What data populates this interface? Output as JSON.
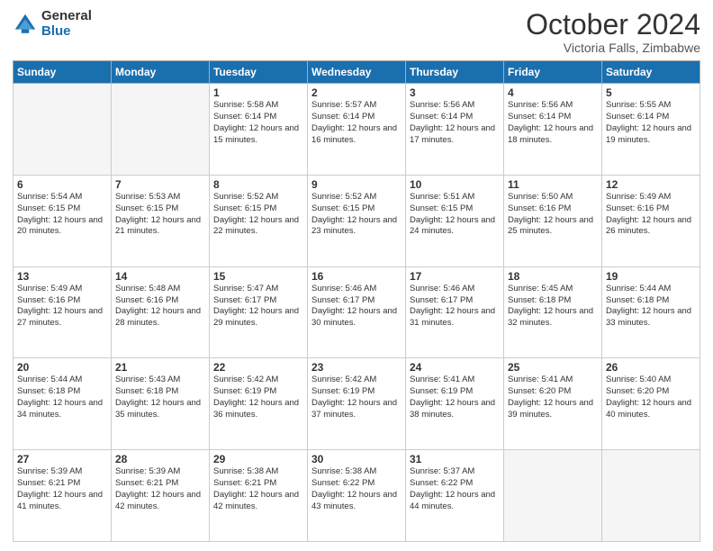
{
  "logo": {
    "general": "General",
    "blue": "Blue"
  },
  "header": {
    "month": "October 2024",
    "location": "Victoria Falls, Zimbabwe"
  },
  "days_of_week": [
    "Sunday",
    "Monday",
    "Tuesday",
    "Wednesday",
    "Thursday",
    "Friday",
    "Saturday"
  ],
  "weeks": [
    [
      {
        "day": "",
        "info": ""
      },
      {
        "day": "",
        "info": ""
      },
      {
        "day": "1",
        "info": "Sunrise: 5:58 AM\nSunset: 6:14 PM\nDaylight: 12 hours and 15 minutes."
      },
      {
        "day": "2",
        "info": "Sunrise: 5:57 AM\nSunset: 6:14 PM\nDaylight: 12 hours and 16 minutes."
      },
      {
        "day": "3",
        "info": "Sunrise: 5:56 AM\nSunset: 6:14 PM\nDaylight: 12 hours and 17 minutes."
      },
      {
        "day": "4",
        "info": "Sunrise: 5:56 AM\nSunset: 6:14 PM\nDaylight: 12 hours and 18 minutes."
      },
      {
        "day": "5",
        "info": "Sunrise: 5:55 AM\nSunset: 6:14 PM\nDaylight: 12 hours and 19 minutes."
      }
    ],
    [
      {
        "day": "6",
        "info": "Sunrise: 5:54 AM\nSunset: 6:15 PM\nDaylight: 12 hours and 20 minutes."
      },
      {
        "day": "7",
        "info": "Sunrise: 5:53 AM\nSunset: 6:15 PM\nDaylight: 12 hours and 21 minutes."
      },
      {
        "day": "8",
        "info": "Sunrise: 5:52 AM\nSunset: 6:15 PM\nDaylight: 12 hours and 22 minutes."
      },
      {
        "day": "9",
        "info": "Sunrise: 5:52 AM\nSunset: 6:15 PM\nDaylight: 12 hours and 23 minutes."
      },
      {
        "day": "10",
        "info": "Sunrise: 5:51 AM\nSunset: 6:15 PM\nDaylight: 12 hours and 24 minutes."
      },
      {
        "day": "11",
        "info": "Sunrise: 5:50 AM\nSunset: 6:16 PM\nDaylight: 12 hours and 25 minutes."
      },
      {
        "day": "12",
        "info": "Sunrise: 5:49 AM\nSunset: 6:16 PM\nDaylight: 12 hours and 26 minutes."
      }
    ],
    [
      {
        "day": "13",
        "info": "Sunrise: 5:49 AM\nSunset: 6:16 PM\nDaylight: 12 hours and 27 minutes."
      },
      {
        "day": "14",
        "info": "Sunrise: 5:48 AM\nSunset: 6:16 PM\nDaylight: 12 hours and 28 minutes."
      },
      {
        "day": "15",
        "info": "Sunrise: 5:47 AM\nSunset: 6:17 PM\nDaylight: 12 hours and 29 minutes."
      },
      {
        "day": "16",
        "info": "Sunrise: 5:46 AM\nSunset: 6:17 PM\nDaylight: 12 hours and 30 minutes."
      },
      {
        "day": "17",
        "info": "Sunrise: 5:46 AM\nSunset: 6:17 PM\nDaylight: 12 hours and 31 minutes."
      },
      {
        "day": "18",
        "info": "Sunrise: 5:45 AM\nSunset: 6:18 PM\nDaylight: 12 hours and 32 minutes."
      },
      {
        "day": "19",
        "info": "Sunrise: 5:44 AM\nSunset: 6:18 PM\nDaylight: 12 hours and 33 minutes."
      }
    ],
    [
      {
        "day": "20",
        "info": "Sunrise: 5:44 AM\nSunset: 6:18 PM\nDaylight: 12 hours and 34 minutes."
      },
      {
        "day": "21",
        "info": "Sunrise: 5:43 AM\nSunset: 6:18 PM\nDaylight: 12 hours and 35 minutes."
      },
      {
        "day": "22",
        "info": "Sunrise: 5:42 AM\nSunset: 6:19 PM\nDaylight: 12 hours and 36 minutes."
      },
      {
        "day": "23",
        "info": "Sunrise: 5:42 AM\nSunset: 6:19 PM\nDaylight: 12 hours and 37 minutes."
      },
      {
        "day": "24",
        "info": "Sunrise: 5:41 AM\nSunset: 6:19 PM\nDaylight: 12 hours and 38 minutes."
      },
      {
        "day": "25",
        "info": "Sunrise: 5:41 AM\nSunset: 6:20 PM\nDaylight: 12 hours and 39 minutes."
      },
      {
        "day": "26",
        "info": "Sunrise: 5:40 AM\nSunset: 6:20 PM\nDaylight: 12 hours and 40 minutes."
      }
    ],
    [
      {
        "day": "27",
        "info": "Sunrise: 5:39 AM\nSunset: 6:21 PM\nDaylight: 12 hours and 41 minutes."
      },
      {
        "day": "28",
        "info": "Sunrise: 5:39 AM\nSunset: 6:21 PM\nDaylight: 12 hours and 42 minutes."
      },
      {
        "day": "29",
        "info": "Sunrise: 5:38 AM\nSunset: 6:21 PM\nDaylight: 12 hours and 42 minutes."
      },
      {
        "day": "30",
        "info": "Sunrise: 5:38 AM\nSunset: 6:22 PM\nDaylight: 12 hours and 43 minutes."
      },
      {
        "day": "31",
        "info": "Sunrise: 5:37 AM\nSunset: 6:22 PM\nDaylight: 12 hours and 44 minutes."
      },
      {
        "day": "",
        "info": ""
      },
      {
        "day": "",
        "info": ""
      }
    ]
  ]
}
